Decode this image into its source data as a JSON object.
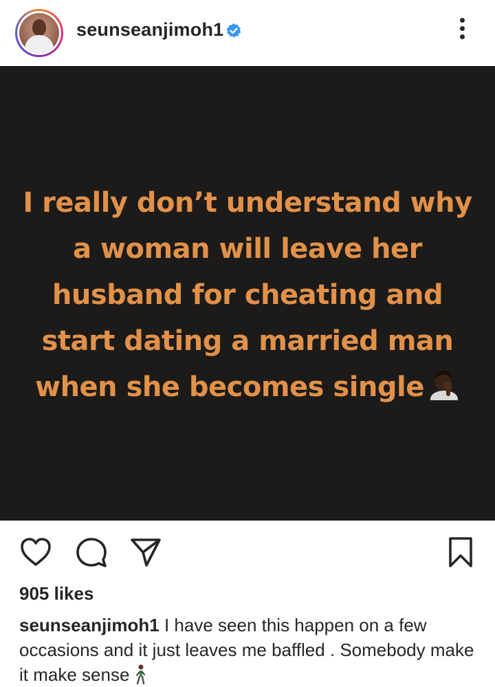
{
  "header": {
    "username": "seunseanjimoh1",
    "verified": true
  },
  "post": {
    "text": "I really don’t understand why a woman will leave her husband for cheating and start dating a married man when she becomes single",
    "emoji": "facepalm",
    "colors": {
      "background": "#1c1b19",
      "text": "#e1914a"
    }
  },
  "actions": {
    "icons": [
      "heart-icon",
      "comment-icon",
      "share-icon",
      "bookmark-icon"
    ]
  },
  "likes": "905 likes",
  "caption": {
    "username": "seunseanjimoh1",
    "text": "I have seen this happen on a few occasions  and it just leaves me baffled . Somebody make it make sense",
    "emoji": "person-walking"
  }
}
